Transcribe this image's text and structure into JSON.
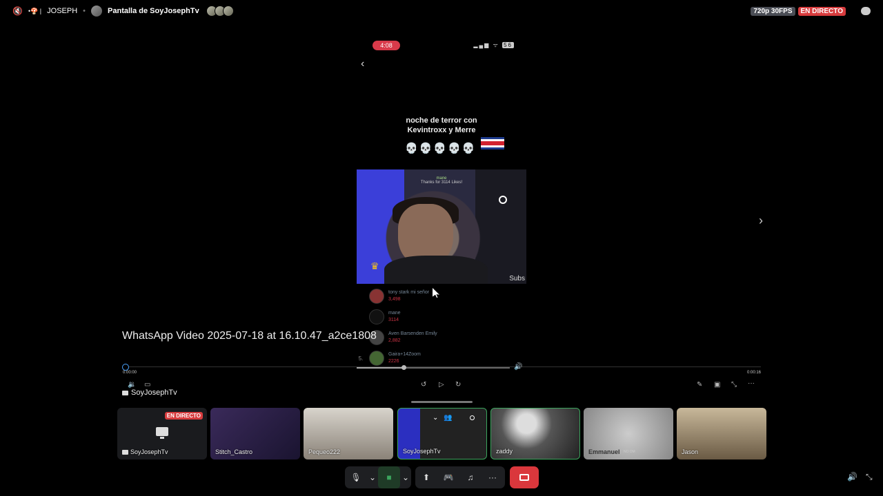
{
  "topbar": {
    "channel_name": "JOSEPH",
    "screen_title": "Pantalla de SoyJosephTv",
    "quality_badge": "720p 30FPS",
    "live_badge": "EN DIRECTO"
  },
  "phone": {
    "time": "4:08",
    "battery": "56",
    "caption_line1": "noche de terror con",
    "caption_line2": "Kevintroxx y Merre",
    "skulls": "💀💀💀💀💀",
    "video_top_user": "mane",
    "video_top_text": "Thanks for 3114 Likes!",
    "video_corner_text": "Subs",
    "leaderboard": [
      {
        "rank": "",
        "name": "tony stark mi señor",
        "value": "3,498"
      },
      {
        "rank": "",
        "name": "mane",
        "value": "3114"
      },
      {
        "rank": "",
        "name": "Aven Barsenden Emily",
        "value": "2,882"
      },
      {
        "rank": "5.",
        "name": "Gaira+14Zoom",
        "value": "2226"
      }
    ]
  },
  "player": {
    "file_title": "WhatsApp Video 2025-07-18 at 16.10.47_a2ce1808",
    "time_current": "0:00:00",
    "time_total": "0:00:16",
    "progress": 0.0,
    "inner_progress": 0.31,
    "owner": "SoyJosephTv"
  },
  "participants": [
    {
      "name": "SoyJosephTv",
      "live": "EN DIRECTO",
      "type": "stream"
    },
    {
      "name": "Stitch_Castro",
      "type": "camera"
    },
    {
      "name": "Pequeo222",
      "type": "camera"
    },
    {
      "name": "SoyJosephTv",
      "type": "camera",
      "active": true
    },
    {
      "name": "zaddy",
      "type": "camera",
      "active": true
    },
    {
      "name": "Emmanuel",
      "tag": "NO DM",
      "type": "camera"
    },
    {
      "name": "Jason",
      "type": "camera"
    }
  ],
  "icons": {
    "mute": "speaker-muted-icon",
    "chat": "chat-icon",
    "mic": "microphone-icon",
    "cam": "camera-icon",
    "share": "screen-share-icon",
    "activity": "gamepad-icon",
    "soundboard": "soundboard-icon",
    "more": "more-icon",
    "hangup": "hang-up-icon"
  },
  "colors": {
    "live": "#d83c3e",
    "active_border": "#3ba55d",
    "seek_handle": "#4aa3ff",
    "hangup": "#da373c"
  }
}
